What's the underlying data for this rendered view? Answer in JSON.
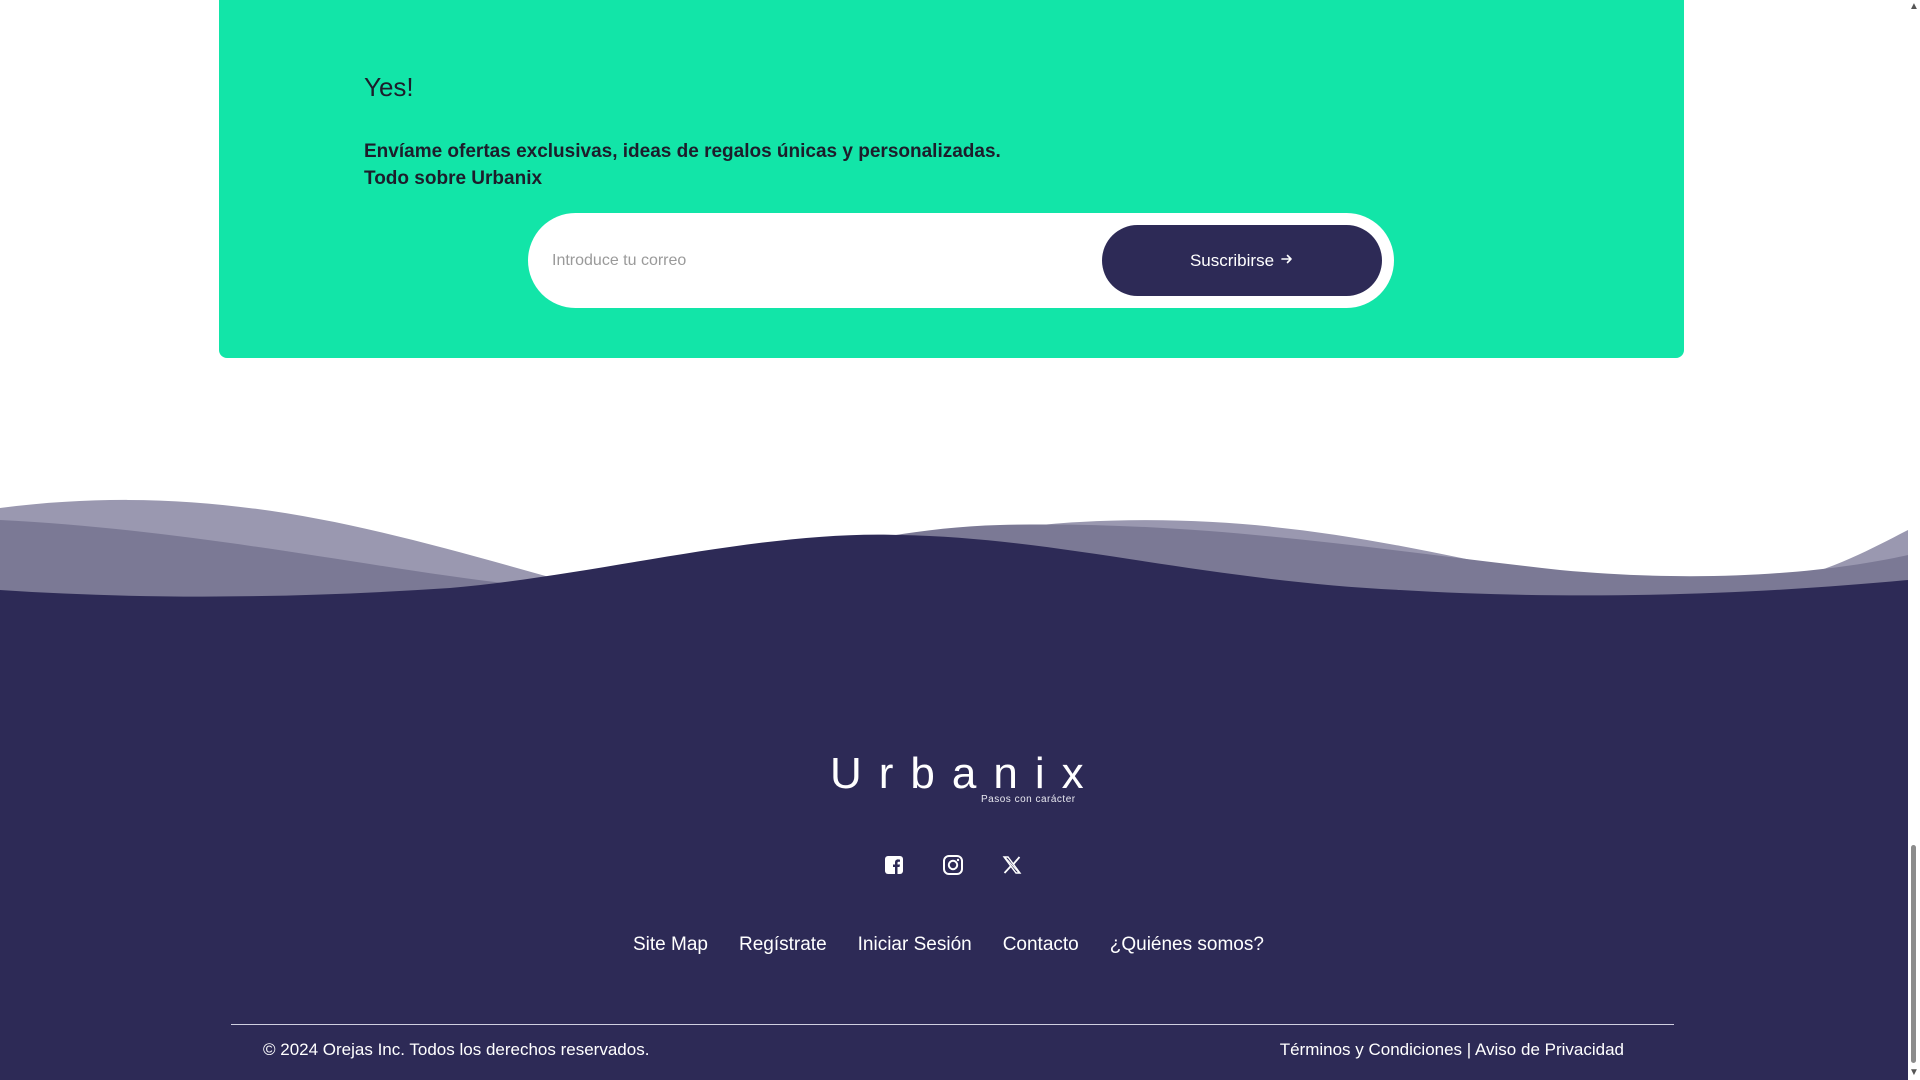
{
  "newsletter": {
    "title": "Yes!",
    "text_line1": "Envíame ofertas exclusivas, ideas de regalos únicas y personalizadas.",
    "text_line2": "Todo sobre Urbanix",
    "input_value": "",
    "input_placeholder": "Introduce tu correo",
    "button_label": "Suscribirse",
    "button_icon": "arrow-right-icon",
    "background_color": "#12e5a8",
    "button_color": "#2d2a56"
  },
  "footer": {
    "background_color": "#2d2a56",
    "logo": {
      "word": "Urbanix",
      "tagline": "Pasos con carácter"
    },
    "socials": [
      {
        "name": "facebook",
        "icon": "facebook-icon"
      },
      {
        "name": "instagram",
        "icon": "instagram-icon"
      },
      {
        "name": "x",
        "icon": "x-twitter-icon"
      }
    ],
    "nav": [
      {
        "label": "Site Map"
      },
      {
        "label": "Regístrate"
      },
      {
        "label": "Iniciar Sesión"
      },
      {
        "label": "Contacto"
      },
      {
        "label": "¿Quiénes somos?"
      }
    ],
    "copyright": "© 2024 Orejas Inc. Todos los derechos reservados.",
    "legal_terms": "Términos y Condiciones",
    "legal_separator": " | ",
    "legal_privacy": "Aviso de Privacidad"
  }
}
